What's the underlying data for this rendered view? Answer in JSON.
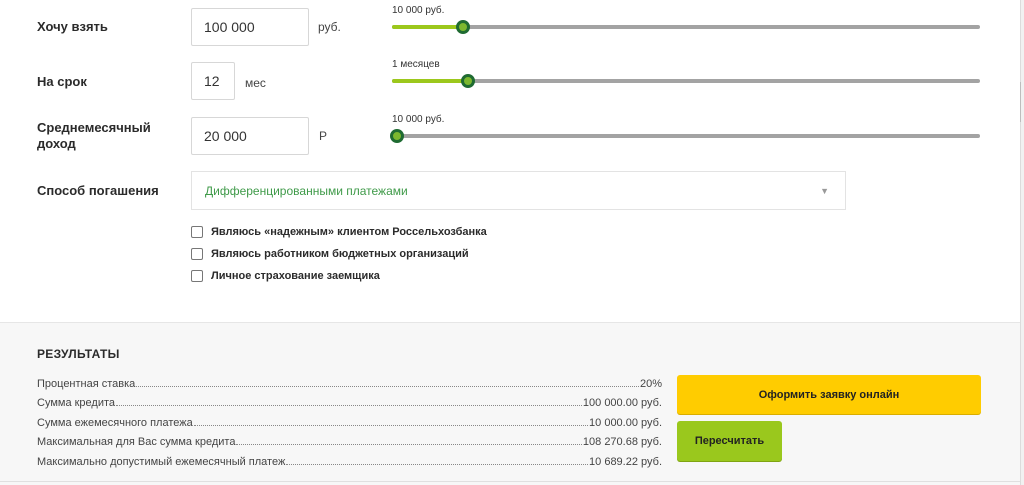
{
  "form": {
    "amount": {
      "label": "Хочу взять",
      "value": "100 000",
      "unit": "руб.",
      "slider_label": "10 000 руб.",
      "slider_fraction": 0.12
    },
    "term": {
      "label": "На срок",
      "value": "12",
      "unit": "мес",
      "slider_label": "1 месяцев",
      "slider_fraction": 0.13
    },
    "income": {
      "label": "Среднемесячный доход",
      "label_line1": "Среднемесячный",
      "label_line2": "доход",
      "value": "20 000",
      "unit": "Р",
      "slider_label": "10 000 руб.",
      "slider_fraction": 0.0
    },
    "repayment": {
      "label": "Способ погашения",
      "selected": "Дифференцированными платежами",
      "icon": "chevron-down-icon"
    },
    "checkboxes": [
      {
        "label": "Являюсь «надежным» клиентом Россельхозбанка",
        "checked": false
      },
      {
        "label": "Являюсь работником бюджетных организаций",
        "checked": false
      },
      {
        "label": "Личное страхование заемщика",
        "checked": false
      }
    ]
  },
  "results": {
    "title": "РЕЗУЛЬТАТЫ",
    "rows": [
      {
        "label": "Процентная ставка",
        "value": "20%"
      },
      {
        "label": "Сумма кредита",
        "value": "100 000.00 руб."
      },
      {
        "label": "Сумма ежемесячного платежа",
        "value": "10 000.00 руб."
      },
      {
        "label": "Максимальная для Вас сумма кредита",
        "value": "108 270.68 руб."
      },
      {
        "label": "Максимально допустимый ежемесячный платеж",
        "value": "10 689.22 руб."
      }
    ],
    "apply_button": "Оформить заявку онлайн",
    "recalc_button": "Пересчитать"
  },
  "colors": {
    "accent_green": "#9cc81c",
    "thumb_border": "#1f6b32",
    "apply_yellow": "#ffcc00",
    "select_text": "#3f9a49"
  }
}
